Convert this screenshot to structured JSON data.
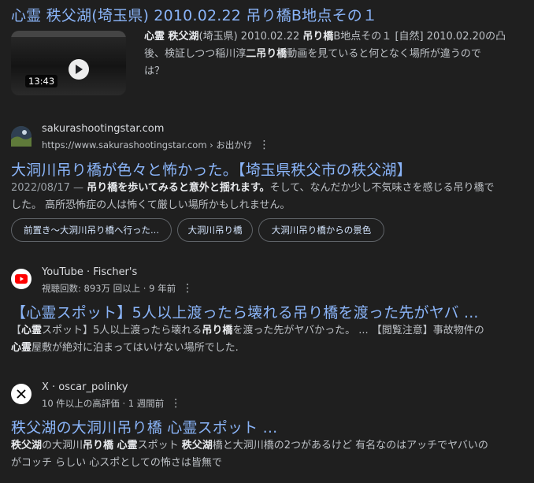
{
  "result1": {
    "title": "心霊 秩父湖(埼玉県) 2010.02.22 吊り橋B地点その１",
    "duration": "13:43",
    "snippet_lines": [
      [
        {
          "t": "心霊 秩父湖",
          "b": true
        },
        {
          "t": "(埼玉県) 2010.02.22 ",
          "b": false
        },
        {
          "t": "吊り橋",
          "b": true
        },
        {
          "t": "B地点その１ [自然] 2010.02.20の凸",
          "b": false
        }
      ],
      [
        {
          "t": "後、検証しつつ稲川淳",
          "b": false
        },
        {
          "t": "二吊り橋",
          "b": true
        },
        {
          "t": "動画を見ていると何となく場所が違うので",
          "b": false
        }
      ],
      [
        {
          "t": "は？",
          "b": false
        }
      ]
    ]
  },
  "result2": {
    "site_name": "sakurashootingstar.com",
    "url": "https://www.sakurashootingstar.com › お出かけ",
    "title": "大洞川吊り橋が色々と怖かった。【埼玉県秩父市の秩父湖】",
    "snippet_lines": [
      [
        {
          "t": "2022/08/17 — ",
          "b": false,
          "m": true
        },
        {
          "t": "吊り橋を歩いてみると意外と揺れます。",
          "b": true
        },
        {
          "t": "そして、なんだか少し不気味さを感じる吊り橋で",
          "b": false
        }
      ],
      [
        {
          "t": "した。 高所恐怖症の人は怖くて厳しい場所かもしれません。",
          "b": false
        }
      ]
    ],
    "chips": [
      "前置き～大洞川吊り橋へ行った...",
      "大洞川吊り橋",
      "大洞川吊り橋からの景色"
    ]
  },
  "result3": {
    "site_name": "YouTube · Fischer's",
    "meta": "視聴回数: 893万 回以上 · 9 年前",
    "title": "【心霊スポット】5人以上渡ったら壊れる吊り橋を渡った先がヤバ ...",
    "snippet_lines": [
      [
        {
          "t": "【",
          "b": false
        },
        {
          "t": "心霊",
          "b": true
        },
        {
          "t": "スポット】5人以上渡ったら壊れる",
          "b": false
        },
        {
          "t": "吊り橋",
          "b": true
        },
        {
          "t": "を渡った先がヤバかった。 ... 【閲覧注意】事故物件の",
          "b": false
        }
      ],
      [
        {
          "t": "心霊",
          "b": true
        },
        {
          "t": "屋敷が絶対に泊まってはいけない場所でした.",
          "b": false
        }
      ]
    ]
  },
  "result4": {
    "site_name": "X · oscar_polinky",
    "meta": "10 件以上の高評価 · 1 週間前",
    "title": "秩父湖の大洞川吊り橋 心霊スポット ...",
    "snippet_lines": [
      [
        {
          "t": "秩父湖",
          "b": true
        },
        {
          "t": "の大洞川",
          "b": false
        },
        {
          "t": "吊り橋 心霊",
          "b": true
        },
        {
          "t": "スポット ",
          "b": false
        },
        {
          "t": "秩父湖",
          "b": true
        },
        {
          "t": "橋と大洞川橋の2つがあるけど 有名なのはアッチでヤバいの",
          "b": false
        }
      ],
      [
        {
          "t": "がコッチ らしい 心スポとしての怖さは皆無で",
          "b": false
        }
      ]
    ]
  },
  "more_options_label": "⋮",
  "icons": {
    "play": "play-icon",
    "youtube": "youtube-logo-icon",
    "x": "x-logo-icon",
    "site": "site-favicon-icon",
    "more": "more-options-icon"
  },
  "colors": {
    "background": "#1f1f1f",
    "link": "#8ab4f8",
    "text": "#bdc1c6",
    "youtube_red": "#ff0000"
  }
}
